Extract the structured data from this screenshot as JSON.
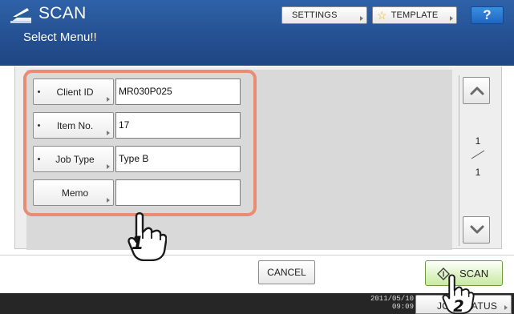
{
  "header": {
    "title": "SCAN",
    "subtitle": "Select Menu!!",
    "settings_label": "SETTINGS",
    "template_label": "TEMPLATE",
    "help_label": "?",
    "icon": "scanner-icon"
  },
  "fields": [
    {
      "label": "Client ID",
      "value": "MR030P025"
    },
    {
      "label": "Item No.",
      "value": "17"
    },
    {
      "label": "Job Type",
      "value": "Type B"
    },
    {
      "label": "Memo",
      "value": ""
    }
  ],
  "pager": {
    "current": "1",
    "total": "1",
    "up_icon": "chevron-up-icon",
    "down_icon": "chevron-down-icon"
  },
  "actions": {
    "cancel_label": "CANCEL",
    "scan_label": "SCAN"
  },
  "status_bar": {
    "date": "2011/05/10",
    "time": "09:09",
    "job_status_label": "JOB STATUS"
  },
  "callouts": [
    "1",
    "2"
  ],
  "colors": {
    "header": "#244f90",
    "highlight_ring": "#e98c73",
    "scan_button": "#c9e9a3",
    "status_bar": "#262626"
  }
}
